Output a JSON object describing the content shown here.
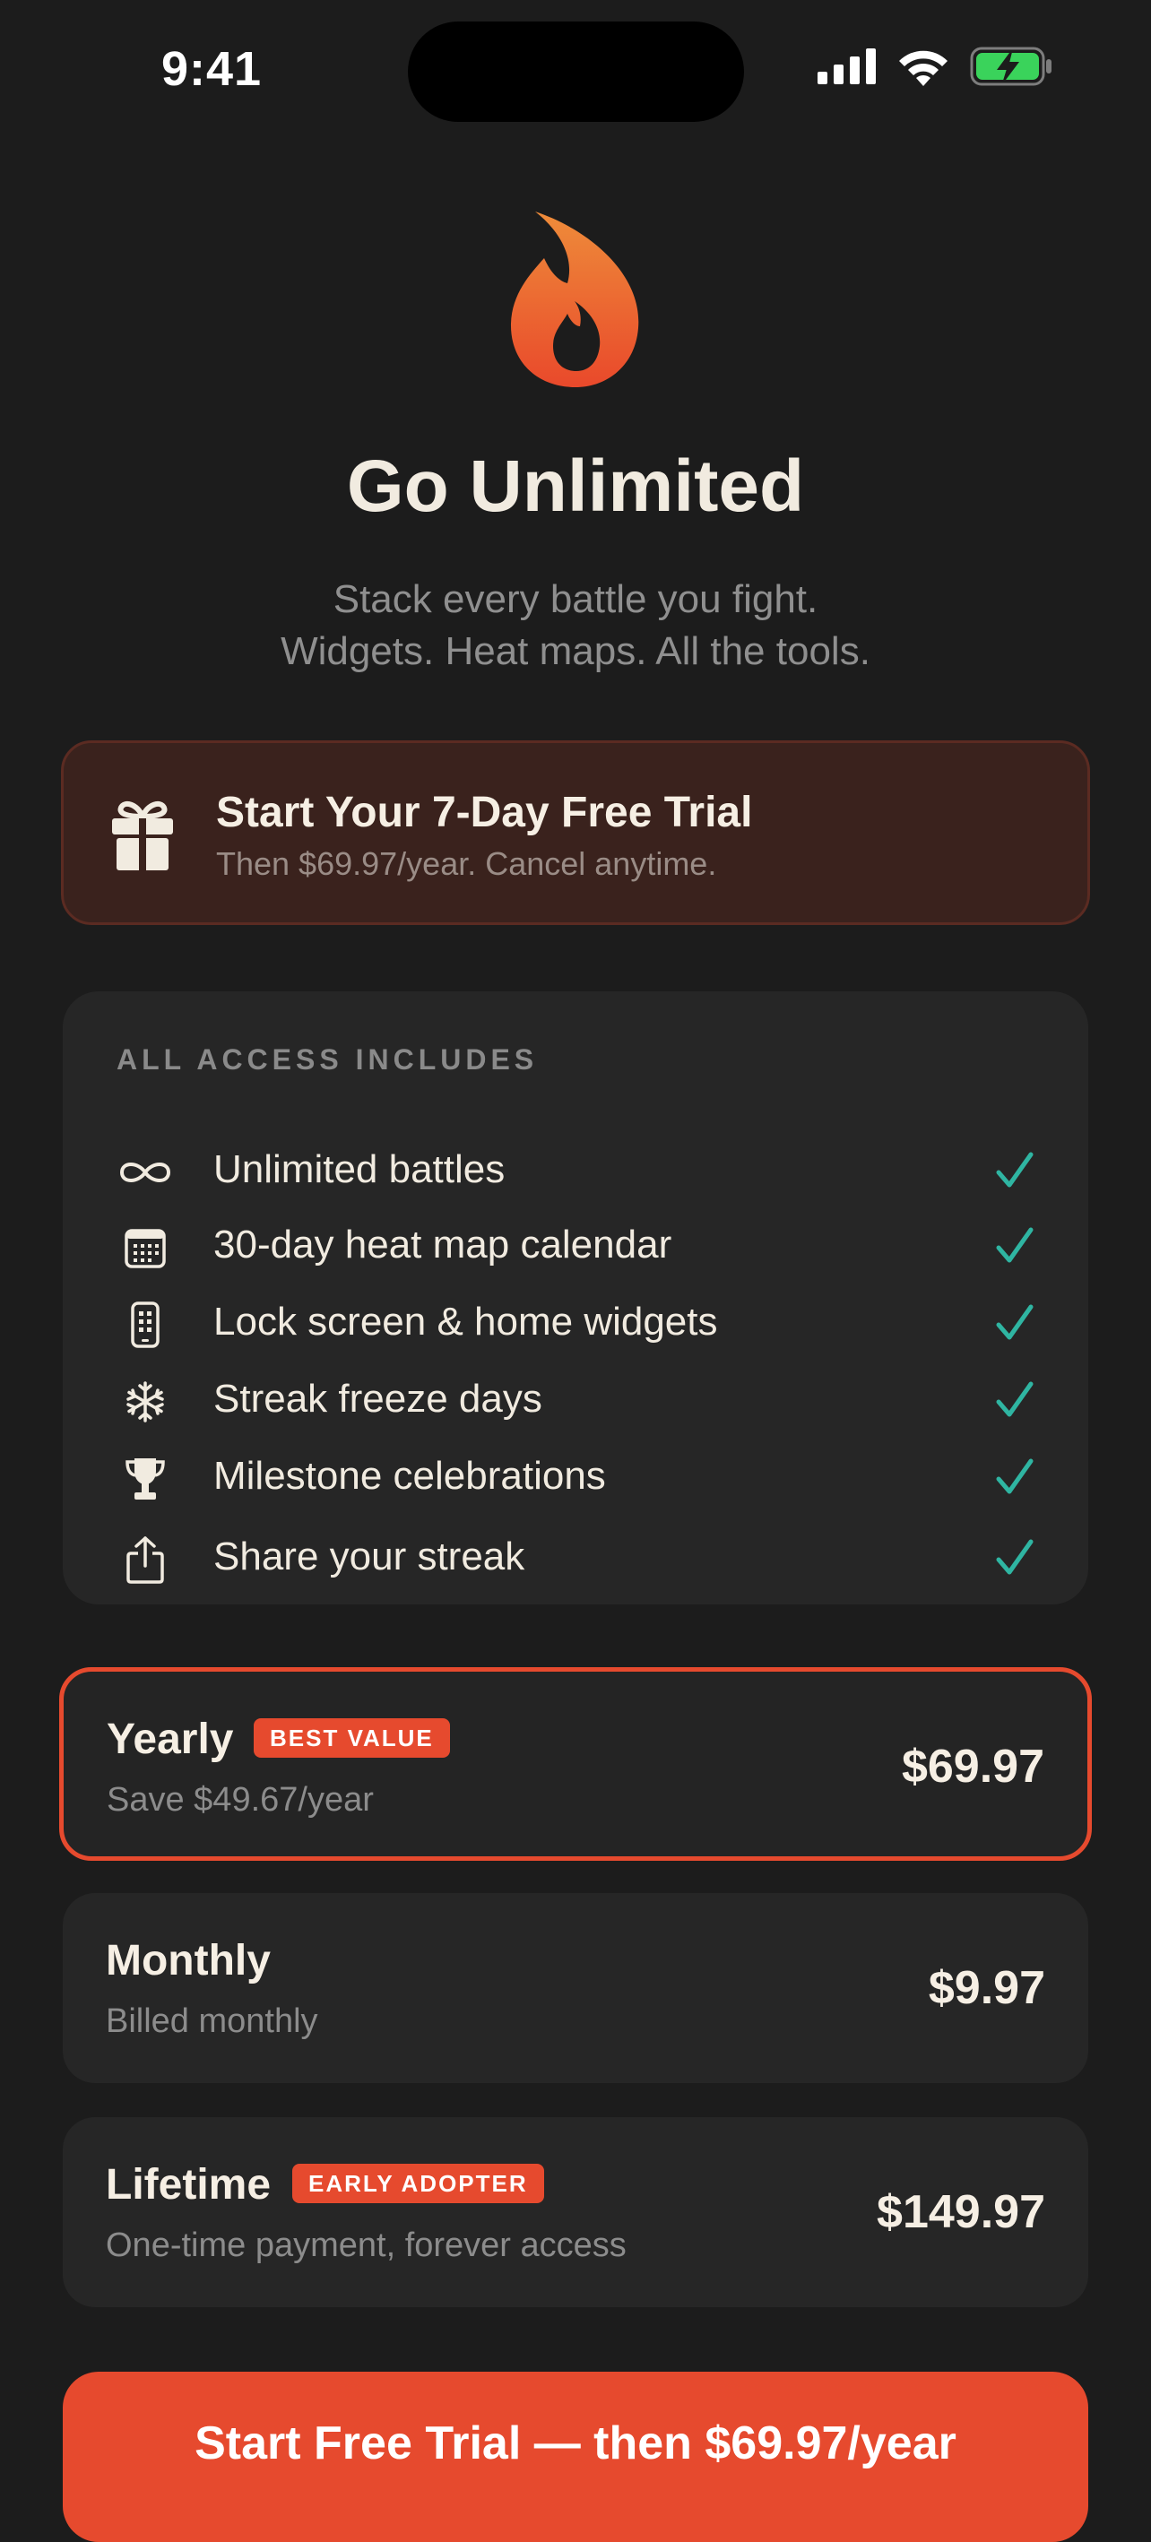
{
  "status_bar": {
    "time": "9:41"
  },
  "hero": {
    "icon": "flame-icon",
    "title": "Go Unlimited",
    "subtitle_line1": "Stack every battle you fight.",
    "subtitle_line2": "Widgets. Heat maps. All the tools."
  },
  "trial_banner": {
    "icon": "gift-icon",
    "title": "Start Your 7-Day Free Trial",
    "subtitle": "Then $69.97/year. Cancel anytime."
  },
  "features": {
    "heading": "ALL ACCESS INCLUDES",
    "items": [
      {
        "icon": "infinity-icon",
        "label": "Unlimited battles"
      },
      {
        "icon": "calendar-icon",
        "label": "30-day heat map calendar"
      },
      {
        "icon": "phone-icon",
        "label": "Lock screen & home widgets"
      },
      {
        "icon": "snowflake-icon",
        "label": "Streak freeze days"
      },
      {
        "icon": "trophy-icon",
        "label": "Milestone celebrations"
      },
      {
        "icon": "share-icon",
        "label": "Share your streak"
      }
    ]
  },
  "plans": [
    {
      "name": "Yearly",
      "badge": "BEST VALUE",
      "subtitle": "Save $49.67/year",
      "price": "$69.97",
      "selected": true
    },
    {
      "name": "Monthly",
      "badge": "",
      "subtitle": "Billed monthly",
      "price": "$9.97",
      "selected": false
    },
    {
      "name": "Lifetime",
      "badge": "EARLY ADOPTER",
      "subtitle": "One-time payment, forever access",
      "price": "$149.97",
      "selected": false
    }
  ],
  "cta": {
    "label": "Start Free Trial — then $69.97/year"
  },
  "colors": {
    "background": "#1c1c1c",
    "accent": "#e64a2e",
    "check": "#2fb5a2",
    "card": "#262626",
    "trial_bg": "#3a221d"
  }
}
